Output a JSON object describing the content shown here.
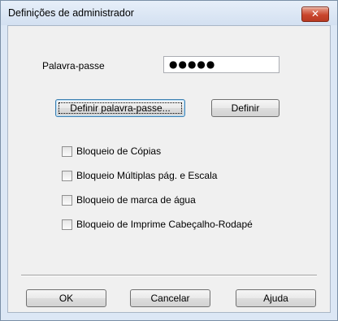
{
  "window": {
    "title": "Definições de administrador",
    "close_glyph": "✕"
  },
  "password": {
    "label": "Palavra-passe",
    "value": "●●●●●"
  },
  "buttons": {
    "set_password": "Definir palavra-passe...",
    "define": "Definir",
    "ok": "OK",
    "cancel": "Cancelar",
    "help": "Ajuda"
  },
  "locks": [
    {
      "label": "Bloqueio de Cópias",
      "checked": false
    },
    {
      "label": "Bloqueio Múltiplas pág. e Escala",
      "checked": false
    },
    {
      "label": "Bloqueio de marca de água",
      "checked": false
    },
    {
      "label": "Bloqueio de Imprime Cabeçalho-Rodapé",
      "checked": false
    }
  ],
  "colors": {
    "frame": "#dce7f5",
    "client": "#f0f0f0",
    "close_button": "#c9462d"
  }
}
